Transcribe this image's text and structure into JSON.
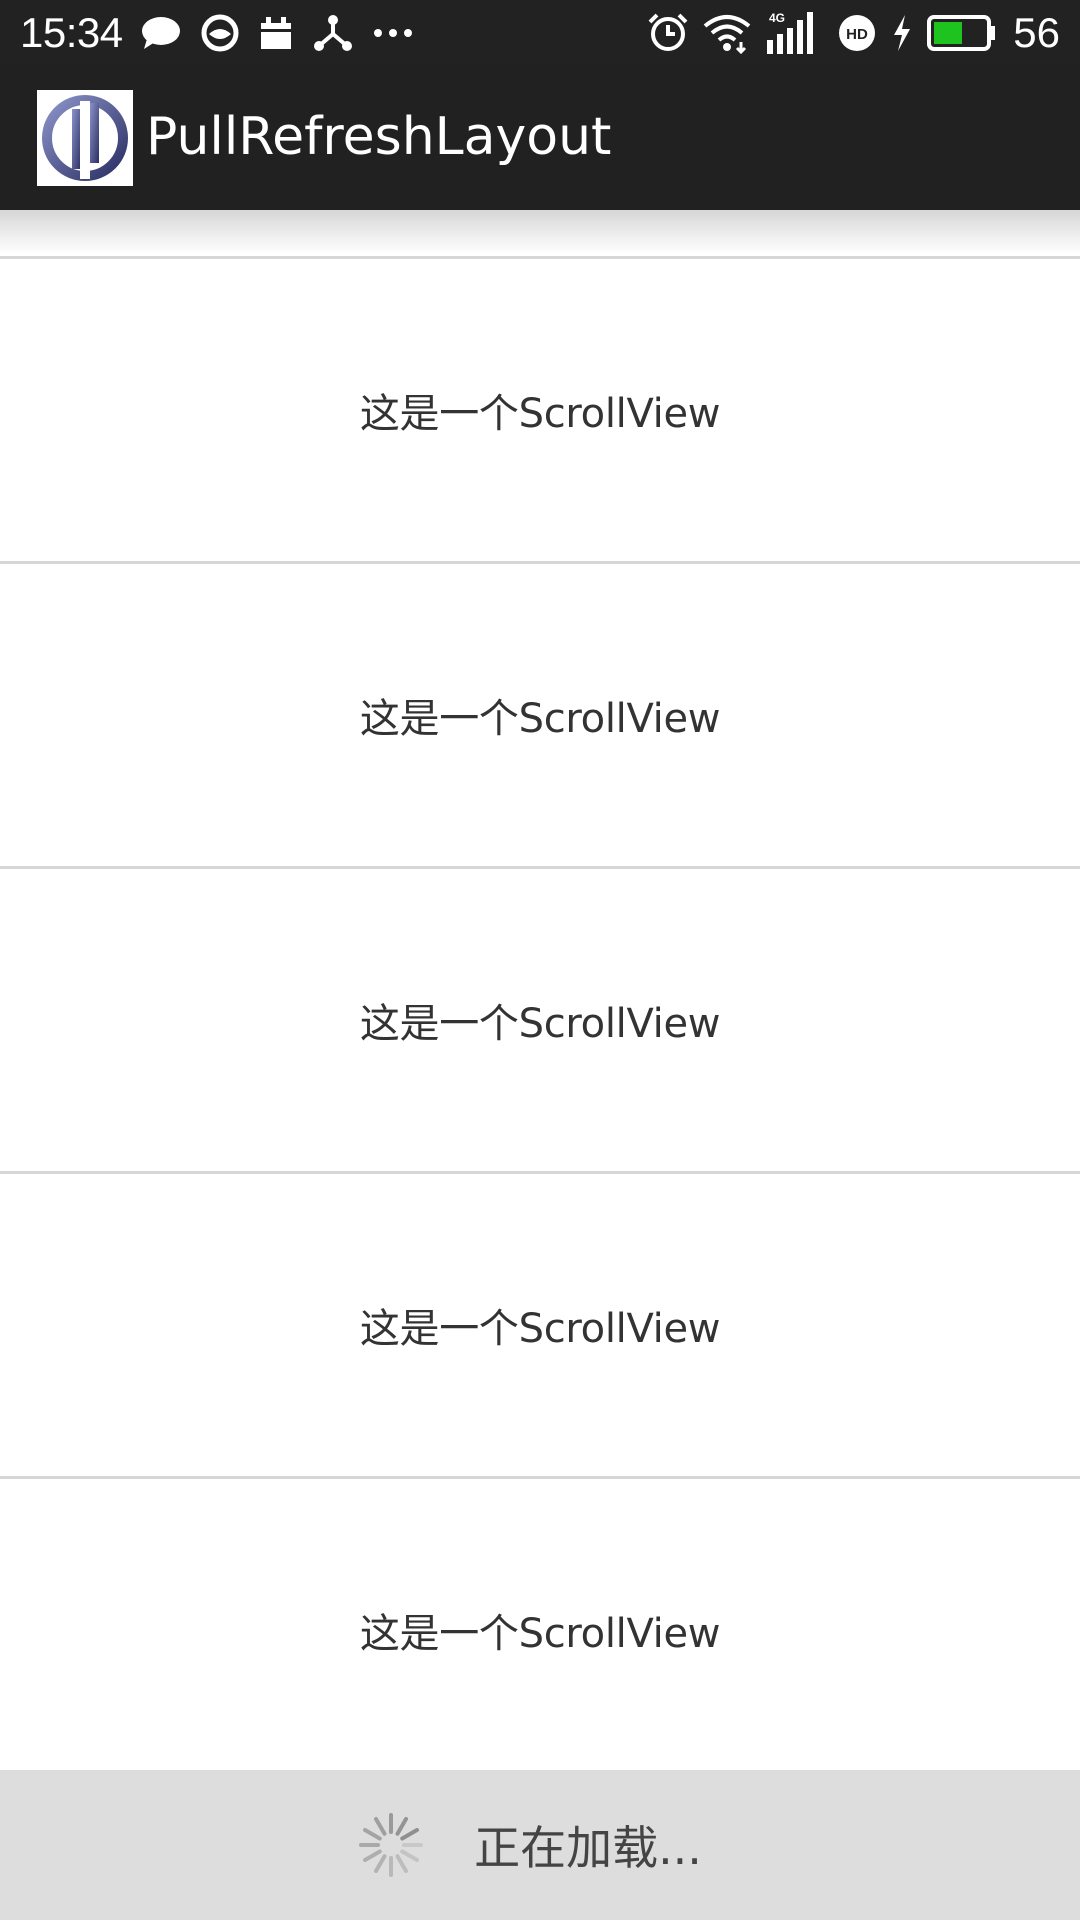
{
  "status_bar": {
    "time": "15:34",
    "battery_level": "56",
    "left_icons": [
      "message-icon",
      "browser-icon",
      "calendar-icon",
      "share-icon",
      "more-icon"
    ],
    "right_icons": [
      "alarm-icon",
      "wifi-icon",
      "signal-4g-icon",
      "hd-icon",
      "charging-icon",
      "battery-icon"
    ],
    "network_label": "4G",
    "hd_label": "HD",
    "battery_color": "#1fc31f"
  },
  "toolbar": {
    "title": "PullRefreshLayout",
    "logo_icon": "app-logo-icon",
    "background": "#212121"
  },
  "list": {
    "items": [
      {
        "text": "这是一个ScrollView"
      },
      {
        "text": "这是一个ScrollView"
      },
      {
        "text": "这是一个ScrollView"
      },
      {
        "text": "这是一个ScrollView"
      },
      {
        "text": "这是一个ScrollView"
      }
    ]
  },
  "footer": {
    "loading_text": "正在加载...",
    "spinner_icon": "spinner-icon",
    "background": "#dddddd"
  }
}
